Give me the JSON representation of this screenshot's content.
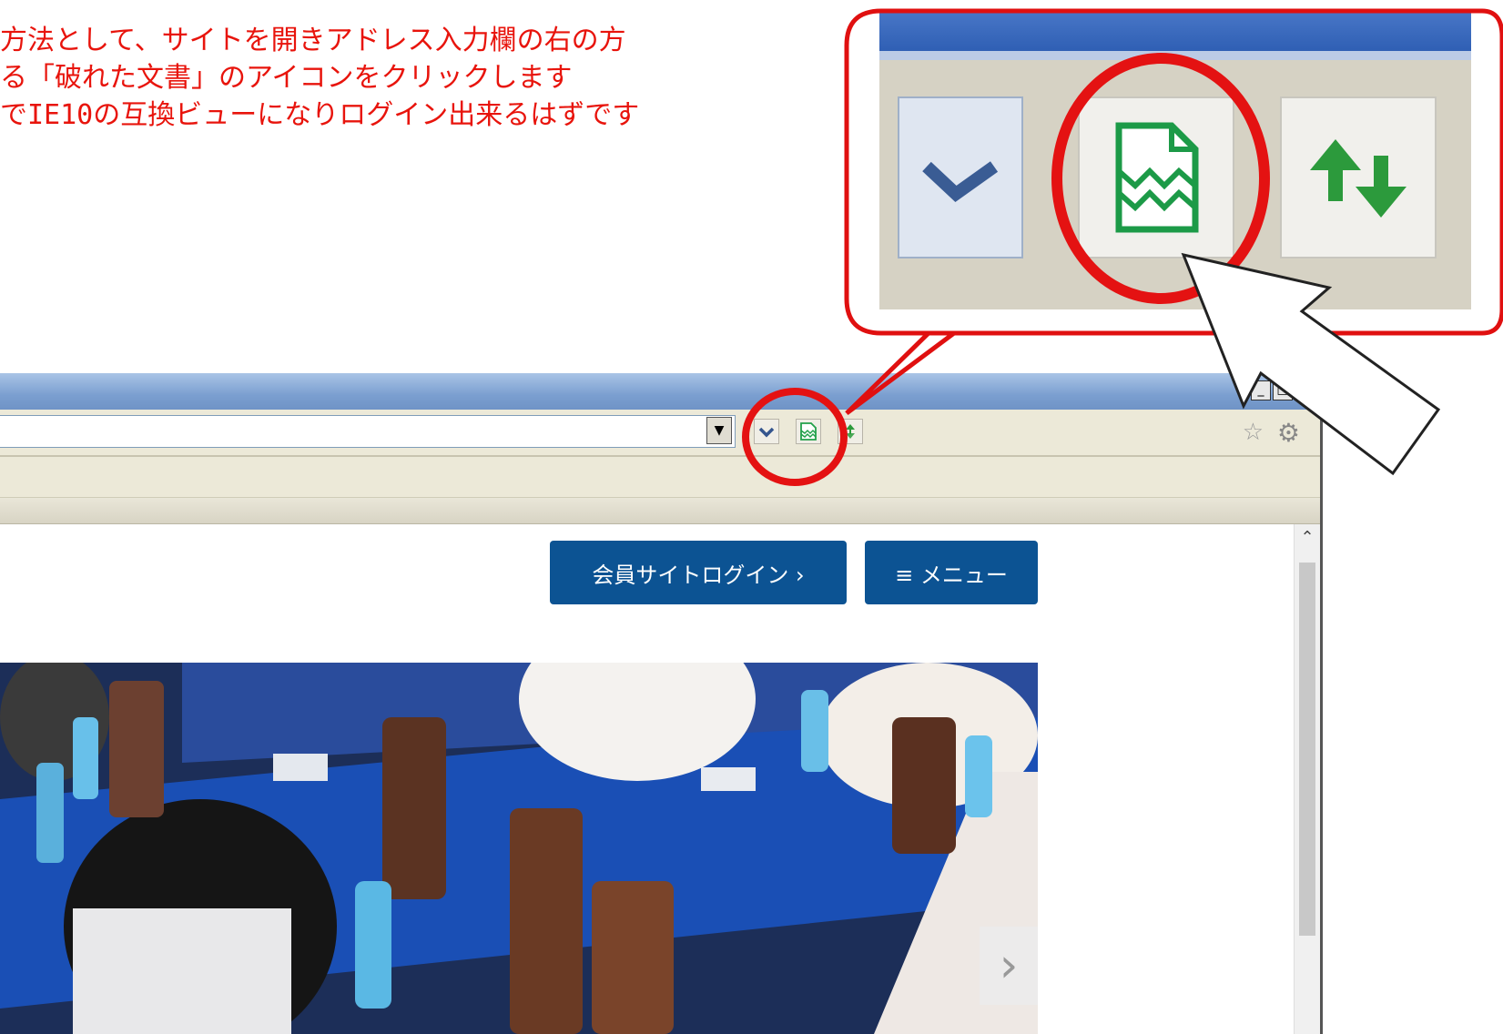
{
  "annotation": {
    "lines": [
      "方法として、サイトを開きアドレス入力欄の右の方",
      "る「破れた文書」のアイコンをクリックします",
      "でIE10の互換ビューになりログイン出来るはずです"
    ],
    "color": "#e8140c"
  },
  "toolbar": {
    "icons": [
      "check-dropdown-icon",
      "compatibility-view-icon",
      "refresh-arrows-icon"
    ],
    "right_icons": [
      "favorites-star-icon",
      "gear-icon"
    ]
  },
  "window_controls": [
    "_",
    "□",
    "×"
  ],
  "site": {
    "login_button": "会員サイトログイン ›",
    "menu_button": "≡ メニュー",
    "accent": "#0c5393"
  },
  "carousel": {
    "next": "›"
  }
}
